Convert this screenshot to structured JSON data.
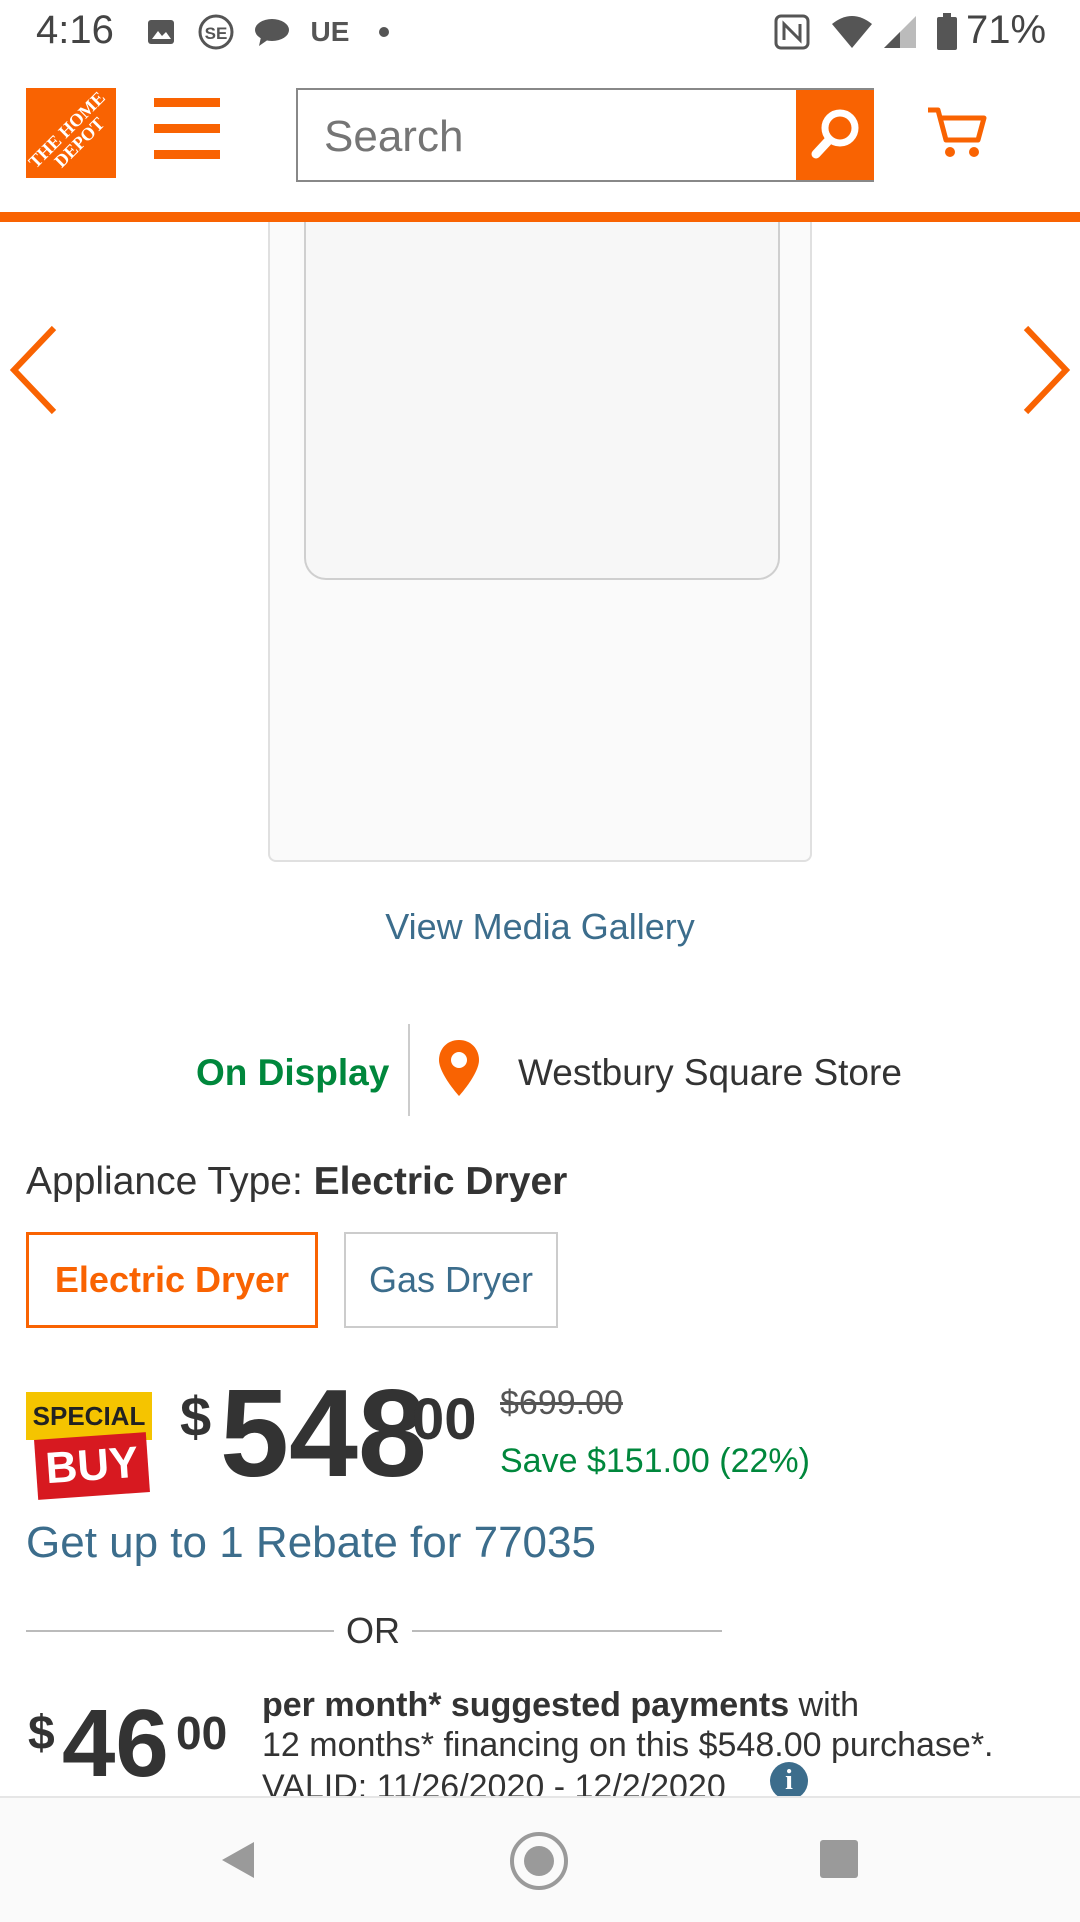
{
  "status_bar": {
    "time": "4:16",
    "network_label": "UE",
    "battery": "71%",
    "icons": [
      "gallery-icon",
      "se-icon",
      "chat-icon",
      "dot-icon",
      "nfc-icon",
      "wifi-icon",
      "signal-icon",
      "battery-icon"
    ]
  },
  "header": {
    "logo_text": "THE HOME DEPOT",
    "search_placeholder": "Search",
    "colors": {
      "brand": "#f96302"
    }
  },
  "gallery": {
    "link": "View Media Gallery"
  },
  "store": {
    "status": "On Display",
    "name": "Westbury Square Store"
  },
  "appliance": {
    "label": "Appliance Type:",
    "value": "Electric Dryer",
    "options": [
      {
        "label": "Electric Dryer",
        "selected": true
      },
      {
        "label": "Gas Dryer",
        "selected": false
      }
    ]
  },
  "price": {
    "badge_top": "SPECIAL",
    "badge_bottom": "BUY",
    "currency": "$",
    "dollars": "548",
    "cents": "00",
    "was": "$699.00",
    "save": "Save $151.00 (22%)",
    "rebate": "Get up to 1 Rebate for 77035"
  },
  "or_text": "OR",
  "financing": {
    "currency": "$",
    "dollars": "46",
    "cents": "00",
    "line1_bold": "per month* suggested payments",
    "line1_rest": " with",
    "line2": "12 months* financing on this $548.00 purchase*.",
    "line3": "VALID: 11/26/2020 - 12/2/2020",
    "info": "i"
  }
}
